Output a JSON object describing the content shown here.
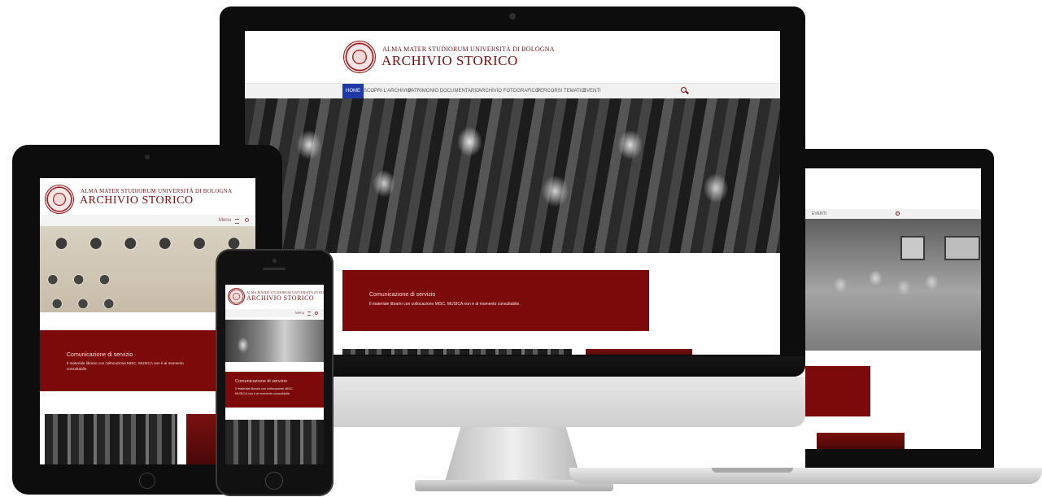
{
  "site": {
    "university_line": "ALMA MATER STUDIORUM UNIVERSITÀ DI BOLOGNA",
    "title": "ARCHIVIO STORICO"
  },
  "nav": {
    "items": [
      "HOME",
      "SCOPRI L'ARCHIVIO",
      "PATRIMONIO DOCUMENTARIO",
      "ARCHIVIO FOTOGRAFICO",
      "PERCORSI TEMATICI",
      "EVENTI"
    ],
    "active_index": 0,
    "laptop_visible": "EVENTI",
    "search_icon": "search-icon"
  },
  "mobile_menu": {
    "label": "Menu",
    "menu_icon": "hamburger-icon",
    "search_icon": "search-icon"
  },
  "notice": {
    "title": "Comunicazione di servizio",
    "message_desktop": "Il materiale librario con collocazione MISC. MUSICA non è al momento consultabile.",
    "message_tablet_1": "Il materiale librario con collocazione MISC. MUSICA non è al momento",
    "message_tablet_2": "consultabile.",
    "message_phone_1": "Il materiale librario con collocazione MISC.",
    "message_phone_2": "MUSICA non è al momento consultabile."
  },
  "colors": {
    "brand_red": "#7d0a0a",
    "nav_active": "#1f3aa8",
    "device_black": "#0d0d0d"
  }
}
